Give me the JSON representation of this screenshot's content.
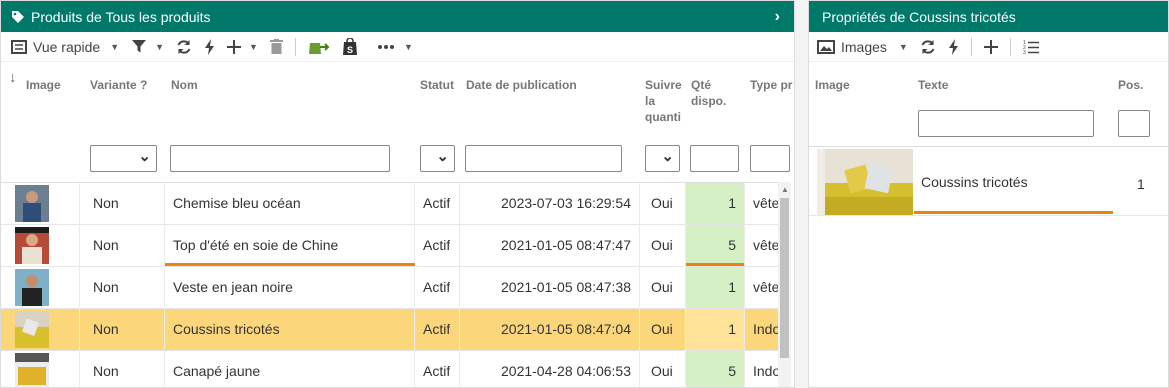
{
  "left": {
    "title": "Produits de Tous les produits",
    "toolbar": {
      "view_label": "Vue rapide"
    },
    "columns": {
      "image": "Image",
      "variant": "Variante ?",
      "name": "Nom",
      "status": "Statut",
      "pubdate": "Date de publication",
      "follow": "Suivre la quanti",
      "qty": "Qté dispo.",
      "type": "Type pr"
    },
    "rows": [
      {
        "variant": "Non",
        "name": "Chemise bleu océan",
        "status": "Actif",
        "date": "2023-07-03 16:29:54",
        "follow": "Oui",
        "qty": "1",
        "type": "vête"
      },
      {
        "variant": "Non",
        "name": "Top d'été en soie de Chine",
        "status": "Actif",
        "date": "2021-01-05 08:47:47",
        "follow": "Oui",
        "qty": "5",
        "type": "vête"
      },
      {
        "variant": "Non",
        "name": "Veste en jean noire",
        "status": "Actif",
        "date": "2021-01-05 08:47:38",
        "follow": "Oui",
        "qty": "1",
        "type": "vête"
      },
      {
        "variant": "Non",
        "name": "Coussins tricotés",
        "status": "Actif",
        "date": "2021-01-05 08:47:04",
        "follow": "Oui",
        "qty": "1",
        "type": "Indo"
      },
      {
        "variant": "Non",
        "name": "Canapé jaune",
        "status": "Actif",
        "date": "2021-04-28 04:06:53",
        "follow": "Oui",
        "qty": "5",
        "type": "Indo"
      }
    ]
  },
  "right": {
    "title": "Propriétés de Coussins tricotés",
    "toolbar": {
      "view_label": "Images"
    },
    "columns": {
      "image": "Image",
      "text": "Texte",
      "pos": "Pos."
    },
    "rows": [
      {
        "text": "Coussins tricotés",
        "pos": "1"
      }
    ]
  },
  "colors": {
    "titlebar": "#00796b",
    "selected_row": "#fcd67a",
    "qty_cell": "#d6f0c5",
    "edit_underline": "#e8850f"
  }
}
